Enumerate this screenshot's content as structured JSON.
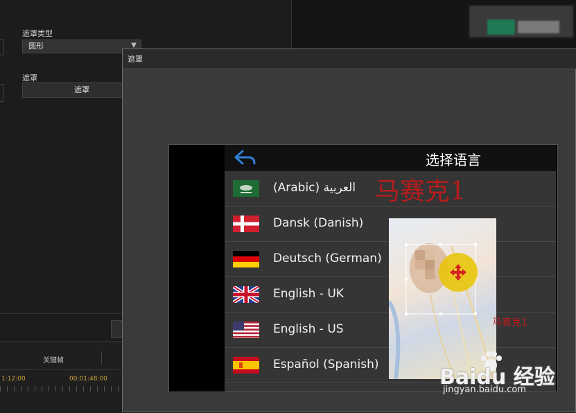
{
  "left_panel": {
    "mask_type_label": "遮罩类型",
    "mask_type_value": "圆形",
    "mask_label": "遮罩",
    "mask_button": "遮罩"
  },
  "timeline": {
    "keyframe_label": "关键帧",
    "time_left": "1:12:00",
    "time_right": "00:01:48:00"
  },
  "dialog": {
    "title": "遮罩"
  },
  "app": {
    "header_title": "选择语言",
    "back_icon": "back-arrow-icon",
    "languages": [
      {
        "label": "(Arabic) العربية",
        "flag": "saudi-arabia-flag"
      },
      {
        "label": "Dansk (Danish)",
        "flag": "denmark-flag"
      },
      {
        "label": "Deutsch (German)",
        "flag": "germany-flag"
      },
      {
        "label": "English - UK",
        "flag": "uk-flag"
      },
      {
        "label": "English - US",
        "flag": "us-flag"
      },
      {
        "label": "Español (Spanish)",
        "flag": "spain-flag"
      }
    ],
    "overlay_text_large": "马赛克1",
    "overlay_text_small": "马赛克1"
  },
  "watermark": {
    "logo_text": "Baidu 经验",
    "url": "jingyan.baidu.com"
  },
  "colors": {
    "accent_red": "#b81c1c",
    "handle_yellow": "#e8c400",
    "back_arrow_blue": "#2f7fd6"
  }
}
